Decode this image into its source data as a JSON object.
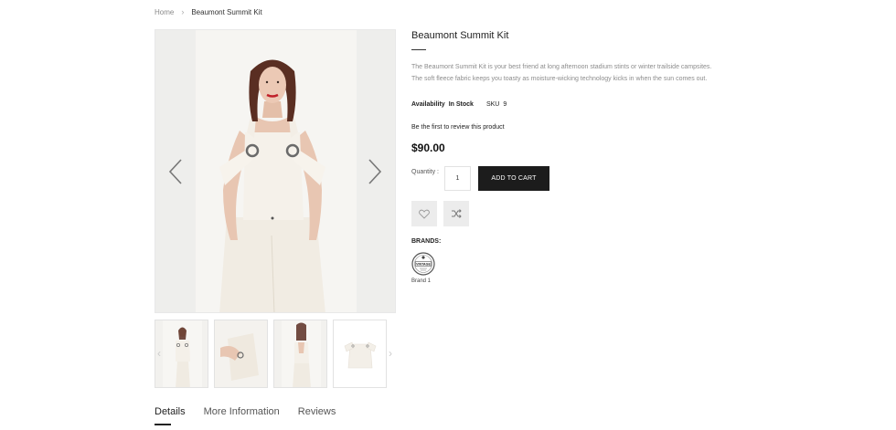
{
  "breadcrumb": {
    "home": "Home",
    "separator": "›",
    "current": "Beaumont Summit Kit"
  },
  "product": {
    "title": "Beaumont Summit Kit",
    "description_line1": "The Beaumont Summit Kit is your best friend at long afternoon stadium stints or winter trailside campsites.",
    "description_line2": "The soft fleece fabric keeps you toasty as moisture-wicking technology kicks in when the sun comes out.",
    "availability_label": "Availability",
    "availability_value": "In Stock",
    "sku_label": "SKU",
    "sku_value": "9",
    "review_prompt": "Be the first to review this product",
    "price": "$90.00",
    "quantity_label": "Quantity :",
    "quantity_value": "1",
    "add_to_cart_label": "ADD TO CART"
  },
  "actions": {
    "wishlist_icon": "heart-icon",
    "compare_icon": "shuffle-icon"
  },
  "brands": {
    "title": "BRANDS:",
    "items": [
      {
        "name": "Brand 1",
        "logo_text": "VINTAGE"
      }
    ]
  },
  "gallery": {
    "prev_icon": "chevron-left-icon",
    "next_icon": "chevron-right-icon",
    "thumbnail_count": 4
  },
  "tabs": [
    {
      "label": "Details",
      "active": true
    },
    {
      "label": "More Information",
      "active": false
    },
    {
      "label": "Reviews",
      "active": false
    }
  ],
  "colors": {
    "accent": "#1c1c1c",
    "muted_text": "#8c8c8c",
    "garment": "#f3eee6"
  }
}
